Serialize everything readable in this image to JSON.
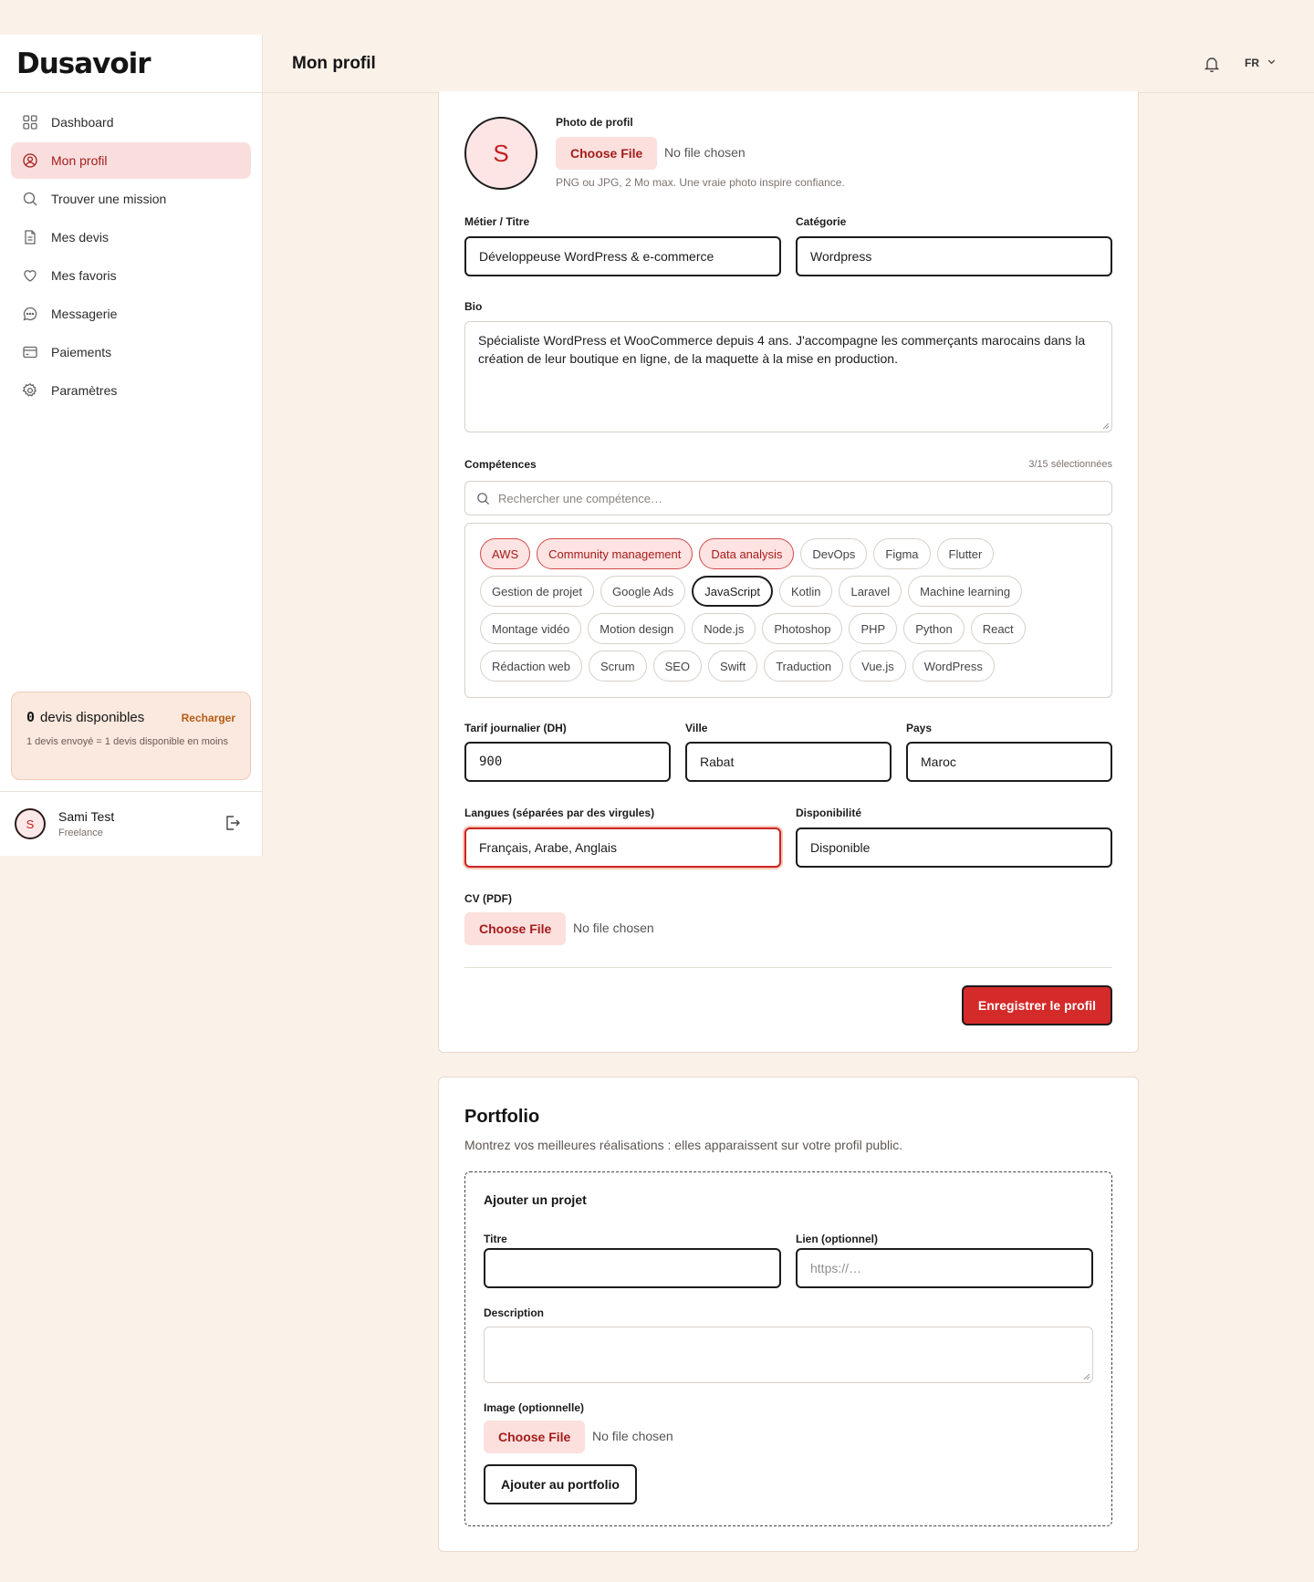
{
  "brand": {
    "logo": "Dusavoir"
  },
  "sidebar": {
    "items": [
      {
        "label": "Dashboard",
        "icon": "grid-icon",
        "active": false
      },
      {
        "label": "Mon profil",
        "icon": "user-circle-icon",
        "active": true
      },
      {
        "label": "Trouver une mission",
        "icon": "search-icon",
        "active": false
      },
      {
        "label": "Mes devis",
        "icon": "document-icon",
        "active": false
      },
      {
        "label": "Mes favoris",
        "icon": "heart-icon",
        "active": false
      },
      {
        "label": "Messagerie",
        "icon": "chat-icon",
        "active": false
      },
      {
        "label": "Paiements",
        "icon": "card-icon",
        "active": false
      },
      {
        "label": "Paramètres",
        "icon": "gear-icon",
        "active": false
      }
    ],
    "credits": {
      "count": "0",
      "label": "devis disponibles",
      "action": "Recharger",
      "note": "1 devis envoyé = 1 devis disponible en moins"
    },
    "user": {
      "initial": "S",
      "name": "Sami Test",
      "role": "Freelance"
    }
  },
  "header": {
    "title": "Mon profil",
    "lang": "FR"
  },
  "profile": {
    "avatar_initial": "S",
    "photo_label": "Photo de profil",
    "choose_file": "Choose File",
    "no_file": "No file chosen",
    "photo_hint": "PNG ou JPG, 2 Mo max. Une vraie photo inspire confiance.",
    "metier_label": "Métier / Titre",
    "metier_value": "Développeuse WordPress & e-commerce",
    "categorie_label": "Catégorie",
    "categorie_value": "Wordpress",
    "bio_label": "Bio",
    "bio_value": "Spécialiste WordPress et WooCommerce depuis 4 ans. J'accompagne les commerçants marocains dans la création de leur boutique en ligne, de la maquette à la mise en production.",
    "skills_label": "Compétences",
    "skills_count": "3/15 sélectionnées",
    "skills_search_placeholder": "Rechercher une compétence…",
    "skills": [
      {
        "label": "AWS",
        "state": "selected"
      },
      {
        "label": "Community management",
        "state": "selected"
      },
      {
        "label": "Data analysis",
        "state": "selected"
      },
      {
        "label": "DevOps",
        "state": "none"
      },
      {
        "label": "Figma",
        "state": "none"
      },
      {
        "label": "Flutter",
        "state": "none"
      },
      {
        "label": "Gestion de projet",
        "state": "none"
      },
      {
        "label": "Google Ads",
        "state": "none"
      },
      {
        "label": "JavaScript",
        "state": "focused"
      },
      {
        "label": "Kotlin",
        "state": "none"
      },
      {
        "label": "Laravel",
        "state": "none"
      },
      {
        "label": "Machine learning",
        "state": "none"
      },
      {
        "label": "Montage vidéo",
        "state": "none"
      },
      {
        "label": "Motion design",
        "state": "none"
      },
      {
        "label": "Node.js",
        "state": "none"
      },
      {
        "label": "Photoshop",
        "state": "none"
      },
      {
        "label": "PHP",
        "state": "none"
      },
      {
        "label": "Python",
        "state": "none"
      },
      {
        "label": "React",
        "state": "none"
      },
      {
        "label": "Rédaction web",
        "state": "none"
      },
      {
        "label": "Scrum",
        "state": "none"
      },
      {
        "label": "SEO",
        "state": "none"
      },
      {
        "label": "Swift",
        "state": "none"
      },
      {
        "label": "Traduction",
        "state": "none"
      },
      {
        "label": "Vue.js",
        "state": "none"
      },
      {
        "label": "WordPress",
        "state": "none"
      }
    ],
    "tarif_label": "Tarif journalier (DH)",
    "tarif_value": "900",
    "ville_label": "Ville",
    "ville_value": "Rabat",
    "pays_label": "Pays",
    "pays_value": "Maroc",
    "langues_label": "Langues (séparées par des virgules)",
    "langues_value": "Français, Arabe, Anglais",
    "dispo_label": "Disponibilité",
    "dispo_value": "Disponible",
    "cv_label": "CV (PDF)",
    "save_label": "Enregistrer le profil"
  },
  "portfolio": {
    "title": "Portfolio",
    "subtitle": "Montrez vos meilleures réalisations : elles apparaissent sur votre profil public.",
    "add_title": "Ajouter un projet",
    "titre_label": "Titre",
    "lien_label": "Lien (optionnel)",
    "lien_placeholder": "https://…",
    "description_label": "Description",
    "image_label": "Image (optionnelle)",
    "choose_file": "Choose File",
    "no_file": "No file chosen",
    "add_button": "Ajouter au portfolio"
  },
  "colors": {
    "accent": "#d52a2a",
    "accent_soft": "#fde3e1",
    "background": "#faf1e8"
  }
}
